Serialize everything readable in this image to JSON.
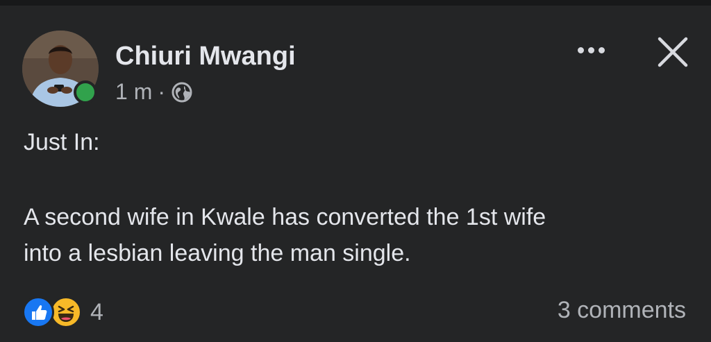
{
  "post": {
    "author": "Chiuri Mwangi",
    "time": "1 m",
    "separator": "·",
    "audience_icon": "globe-icon",
    "more_icon": "more-options-icon",
    "close_icon": "close-icon",
    "body": {
      "line1": "Just In:",
      "line2": "A second wife in Kwale has converted the 1st wife",
      "line3": "into a lesbian leaving the man single."
    },
    "reactions": {
      "types": [
        "like-icon",
        "haha-icon"
      ],
      "count": "4"
    },
    "comments": "3 comments"
  },
  "colors": {
    "background": "#242526",
    "text_primary": "#e4e6eb",
    "text_secondary": "#b0b3b8",
    "online": "#31a24c",
    "like": "#1877f2",
    "haha": "#f7b928"
  }
}
